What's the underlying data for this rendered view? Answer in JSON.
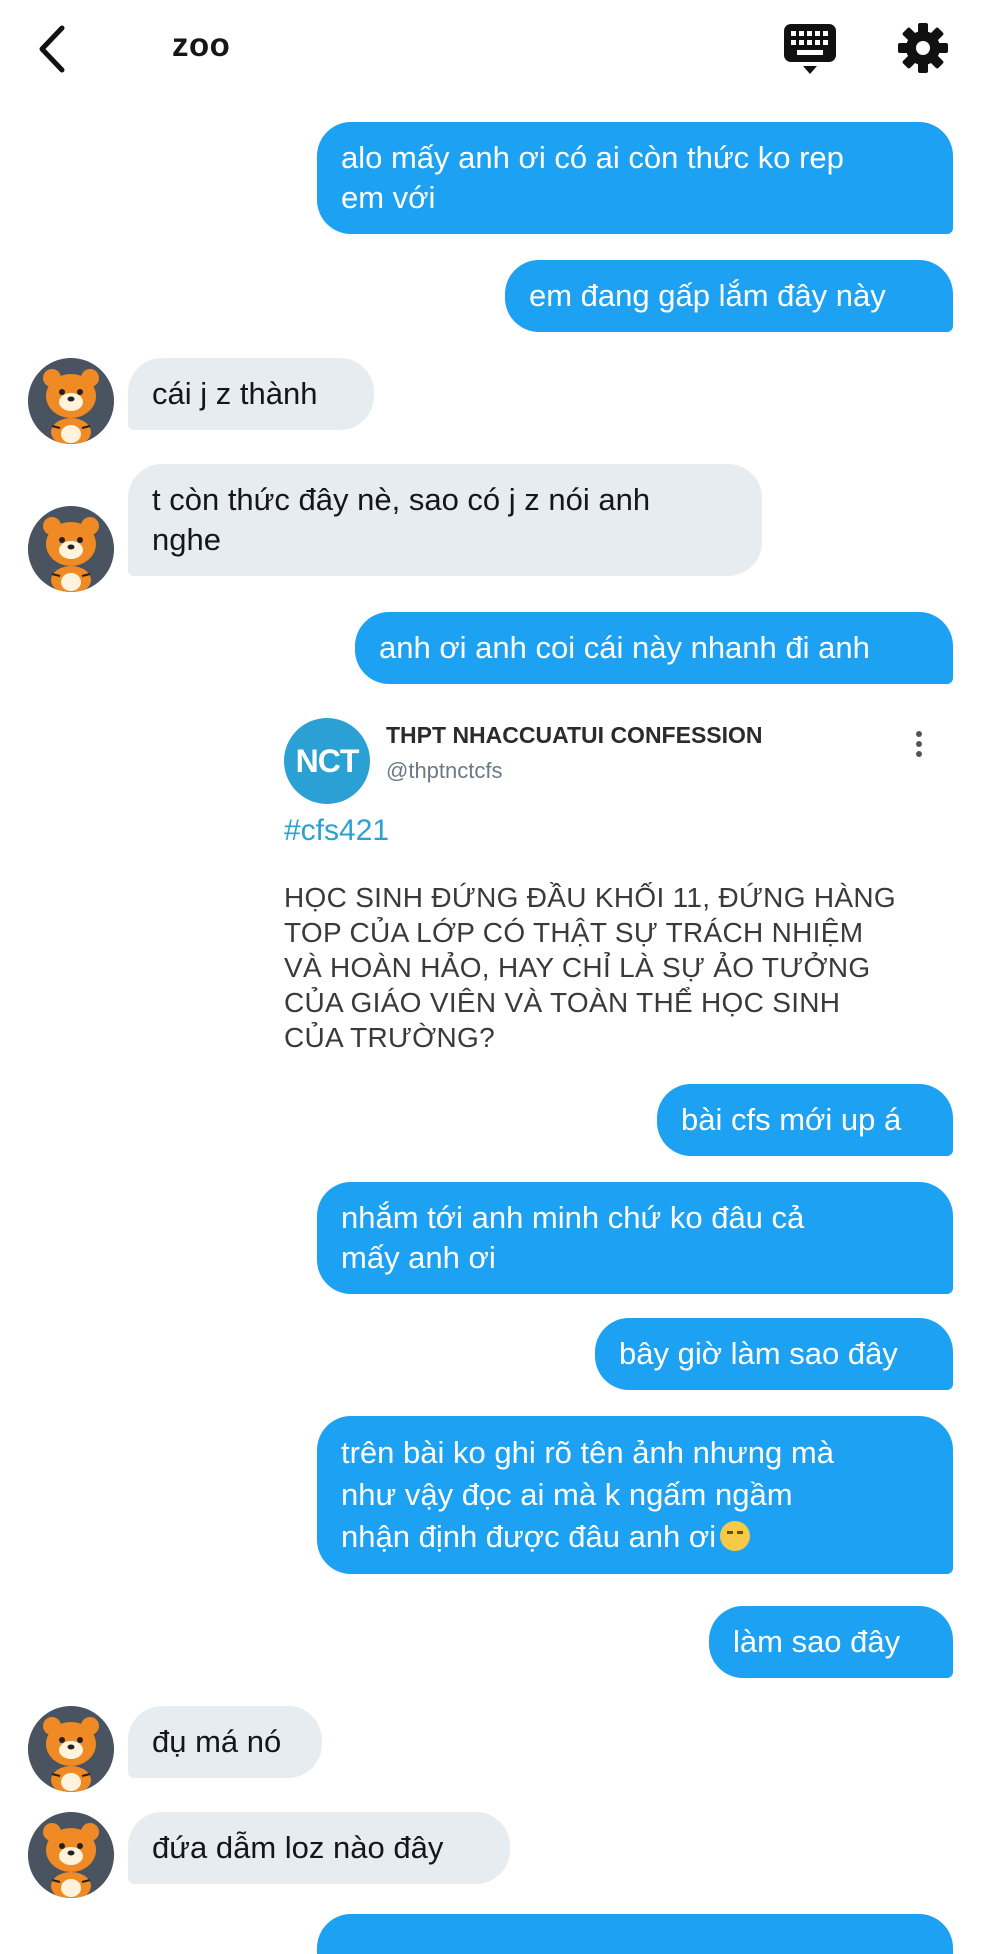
{
  "header": {
    "title": "zoo",
    "back_icon": "chevron-left-icon",
    "keyboard_icon": "keyboard-icon",
    "settings_icon": "gear-icon"
  },
  "messages": [
    {
      "side": "out",
      "text": "alo mấy anh ơi có ai còn thức ko rep\nem với"
    },
    {
      "side": "out",
      "text": "em đang gấp lắm đây này"
    },
    {
      "side": "in",
      "text": "cái j z thành"
    },
    {
      "side": "in",
      "text": "t còn thức đây nè, sao có j z nói anh\nnghe"
    },
    {
      "side": "out",
      "text": "anh ơi anh coi cái này nhanh đi anh"
    },
    {
      "side": "out",
      "text": "bài cfs mới up á"
    },
    {
      "side": "out",
      "text": "nhắm tới anh minh chứ ko đâu cả\nmấy anh ơi"
    },
    {
      "side": "out",
      "text": "bây giờ làm sao đây"
    },
    {
      "side": "out",
      "text": "trên bài ko ghi rõ tên ảnh nhưng mà\nnhư vậy đọc ai mà k ngấm ngầm\nnhận định được đâu anh ơi"
    },
    {
      "side": "out",
      "text": "làm sao đây"
    },
    {
      "side": "in",
      "text": "đụ má nó"
    },
    {
      "side": "in",
      "text": "đứa dẫm loz nào đây"
    }
  ],
  "tweet": {
    "logo_text": "NCT",
    "name": "THPT NHACCUATUI CONFESSION",
    "handle": "@thptnctcfs",
    "hashtag": "#cfs421",
    "body": "HỌC SINH ĐỨNG ĐẦU KHỐI 11, ĐỨNG HÀNG\nTOP CỦA LỚP CÓ THẬT SỰ TRÁCH NHIỆM\nVÀ HOÀN HẢO, HAY CHỈ LÀ SỰ ẢO TƯỞNG\nCỦA GIÁO VIÊN VÀ TOÀN THỂ HỌC SINH\nCỦA TRƯỜNG?"
  },
  "colors": {
    "outgoing": "#1da1f2",
    "incoming": "#e6ecf0",
    "accent": "#2aa0d4"
  }
}
